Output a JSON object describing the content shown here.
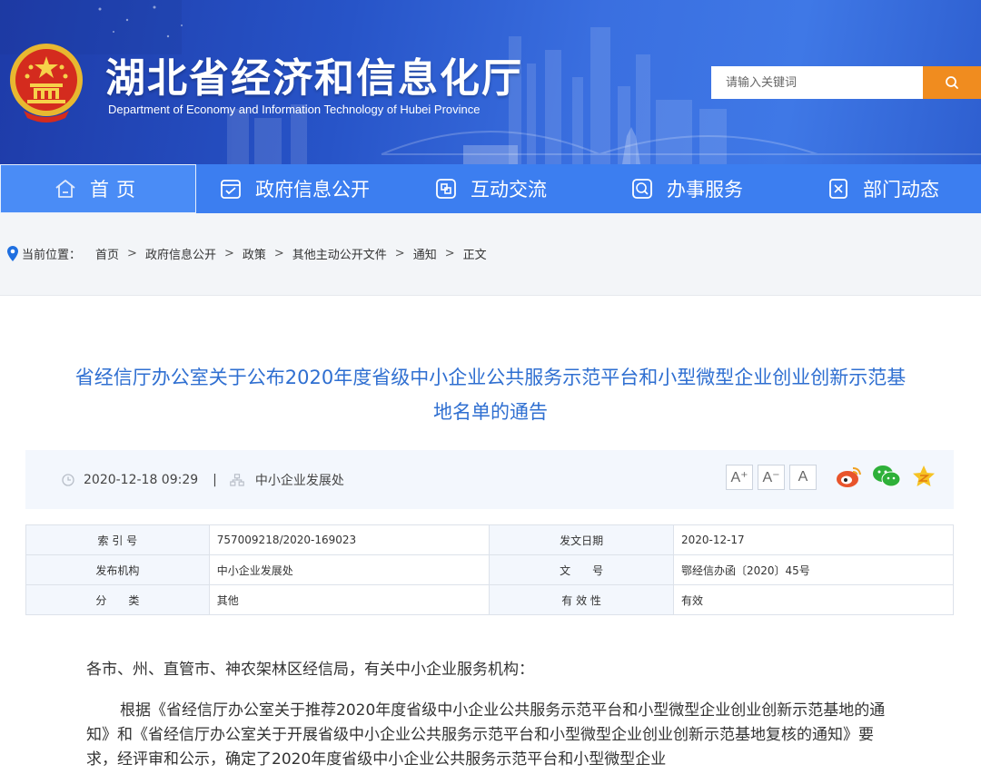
{
  "header": {
    "title": "湖北省经济和信息化厅",
    "subtitle": "Department of Economy and Information Technology of Hubei Province",
    "search_placeholder": "请输入关键词",
    "search_icon": "search-icon",
    "colors": {
      "banner": "#2754c8",
      "nav": "#3c7ef0",
      "search_button": "#f08c1f"
    }
  },
  "nav": {
    "items": [
      {
        "label": "首页",
        "icon": "home-icon"
      },
      {
        "label": "政府信息公开",
        "icon": "document-icon"
      },
      {
        "label": "互动交流",
        "icon": "exchange-icon"
      },
      {
        "label": "办事服务",
        "icon": "service-icon"
      },
      {
        "label": "部门动态",
        "icon": "news-icon"
      }
    ]
  },
  "breadcrumb": {
    "label": "当前位置：",
    "items": [
      "首页",
      "政府信息公开",
      "政策",
      "其他主动公开文件",
      "通知",
      "正文"
    ]
  },
  "article": {
    "title_line1": "省经信厅办公室关于公布2020年度省级中小企业公共服务示范平台和小型微型企业创业创新示范基",
    "title_line2": "地名单的通告",
    "date": "2020-12-18 09:29",
    "divider": "|",
    "department": "中小企业发展处",
    "font_sizes": [
      "A⁺",
      "A⁻",
      "A"
    ],
    "title_color": "#2f6fd1"
  },
  "info_table": {
    "rows": [
      {
        "l1": "索 引 号",
        "v1": "757009218/2020-169023",
        "l2": "发文日期",
        "v2": "2020-12-17"
      },
      {
        "l1": "发布机构",
        "v1": "中小企业发展处",
        "l2": "文　　号",
        "v2": "鄂经信办函〔2020〕45号"
      },
      {
        "l1": "分　　类",
        "v1": "其他",
        "l2": "有 效 性",
        "v2": "有效"
      }
    ]
  },
  "body": {
    "p1": "各市、州、直管市、神农架林区经信局，有关中小企业服务机构：",
    "p2": "根据《省经信厅办公室关于推荐2020年度省级中小企业公共服务示范平台和小型微型企业创业创新示范基地的通知》和《省经信厅办公室关于开展省级中小企业公共服务示范平台和小型微型企业创业创新示范基地复核的通知》要求，经评审和公示，确定了2020年度省级中小企业公共服务示范平台和小型微型企业"
  }
}
